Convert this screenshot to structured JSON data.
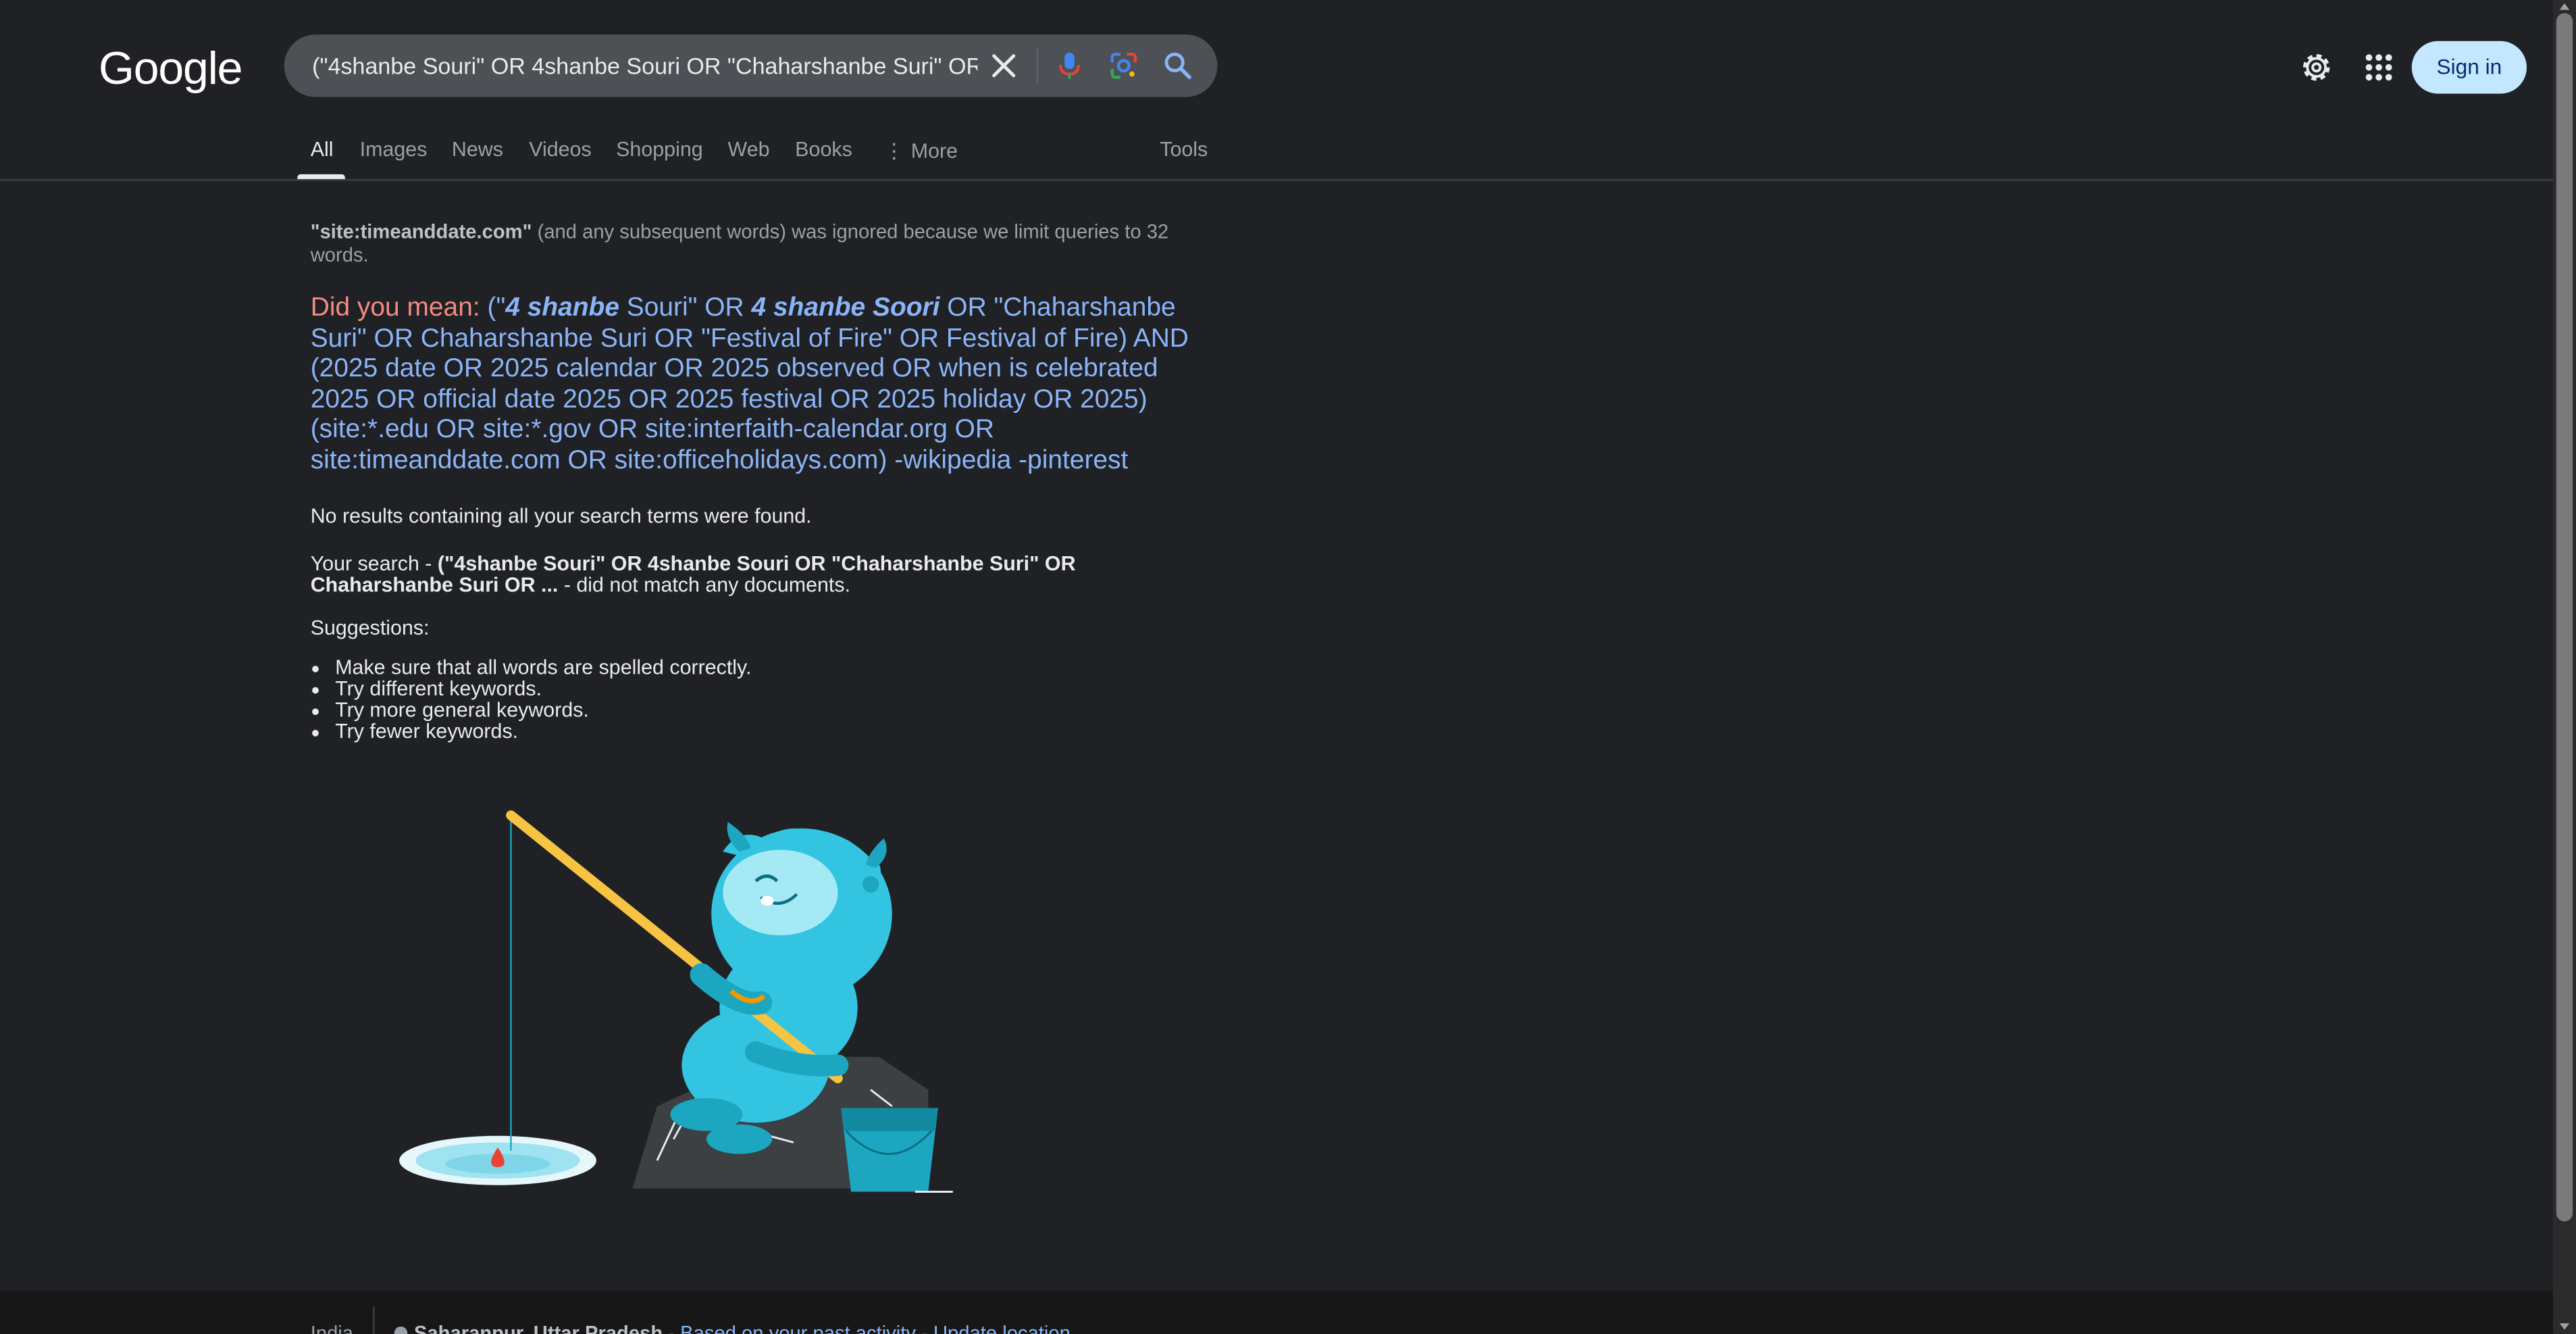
{
  "header": {
    "logo_text": "Google",
    "search_query": "(\"4shanbe Souri\" OR 4shanbe Souri OR \"Chaharshanbe Suri\" OR Chaharshanbe Suri",
    "sign_in_label": "Sign in"
  },
  "tabs": {
    "items": [
      "All",
      "Images",
      "News",
      "Videos",
      "Shopping",
      "Web",
      "Books",
      "More"
    ],
    "active": "All",
    "tools_label": "Tools"
  },
  "main": {
    "ignored_term": "\"site:timeanddate.com\"",
    "ignored_rest": " (and any subsequent words) was ignored because we limit queries to 32 words.",
    "did_you_mean_label": "Did you mean:",
    "dym_parts": {
      "p1": " (\"",
      "b1": "4 shanbe",
      "p2": " Souri\" OR ",
      "b2": "4 shanbe Soori",
      "p3": " OR \"Chaharshanbe Suri\" OR Chaharshanbe Suri OR \"Festival of Fire\" OR Festival of Fire) AND (2025 date OR 2025 calendar OR 2025 observed OR when is celebrated 2025 OR official date 2025 OR 2025 festival OR 2025 holiday OR 2025) (site:*.edu OR site:*.gov OR site:interfaith-calendar.org OR site:timeanddate.com OR site:officeholidays.com) -wikipedia -pinterest"
    },
    "no_results": "No results containing all your search terms were found.",
    "your_search_prefix": "Your search - ",
    "your_search_query": "(\"4shanbe Souri\" OR 4shanbe Souri OR \"Chaharshanbe Suri\" OR Chaharshanbe Suri OR ...",
    "your_search_suffix": " - did not match any documents.",
    "suggestions_title": "Suggestions:",
    "suggestions": [
      "Make sure that all words are spelled correctly.",
      "Try different keywords.",
      "Try more general keywords.",
      "Try fewer keywords."
    ]
  },
  "footer": {
    "country": "India",
    "location": "Saharanpur, Uttar Pradesh",
    "location_sep1": " - ",
    "based_on": "Based on your past activity",
    "location_sep2": " - ",
    "update_location": "Update location"
  },
  "colors": {
    "background": "#202124",
    "link": "#8ab4f8",
    "did_you_mean": "#f28b82",
    "sign_in_bg": "#c2e7ff"
  },
  "icons": [
    "clear-icon",
    "microphone-icon",
    "google-lens-icon",
    "search-icon",
    "settings-gear-icon",
    "apps-grid-icon"
  ]
}
